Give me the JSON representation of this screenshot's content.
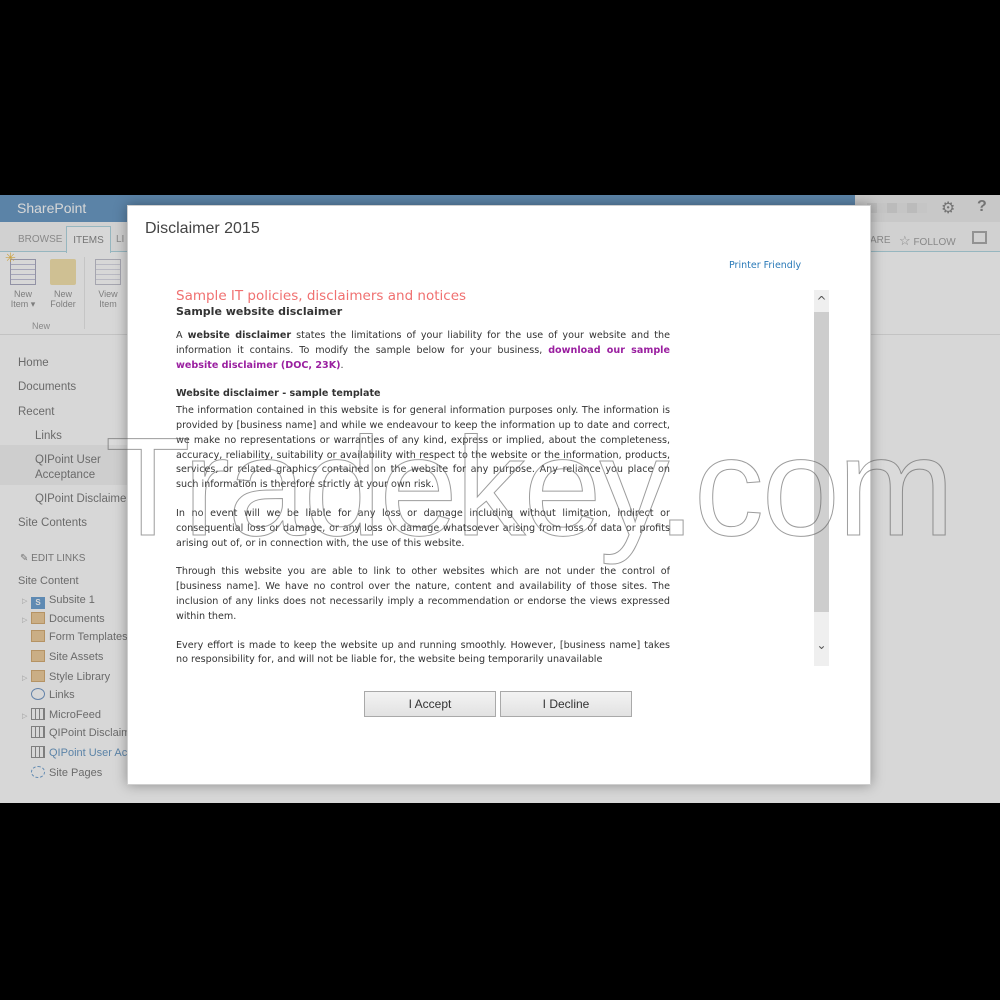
{
  "suitebar": {
    "brand": "SharePoint",
    "settings_icon": "gear-icon",
    "help_label": "?"
  },
  "ribbon": {
    "tabs": [
      {
        "label": "BROWSE"
      },
      {
        "label": "ITEMS",
        "selected": true
      },
      {
        "label": "LI"
      }
    ],
    "share_label": "ARE",
    "follow_label": "FOLLOW",
    "buttons": [
      {
        "label_line1": "New",
        "label_line2": "Item ▾",
        "icon": "new-item-icon"
      },
      {
        "label_line1": "New",
        "label_line2": "Folder",
        "icon": "folder-icon"
      },
      {
        "label_line1": "View",
        "label_line2": "Item",
        "icon": "view-item-icon"
      }
    ],
    "group_label": "New"
  },
  "leftnav": {
    "quicklaunch": [
      {
        "label": "Home"
      },
      {
        "label": "Documents"
      },
      {
        "label": "Recent"
      },
      {
        "label": "Links"
      },
      {
        "label": "QIPoint User"
      },
      {
        "label": "Acceptance"
      },
      {
        "label": "QIPoint Disclaimer"
      },
      {
        "label": "Site Contents"
      }
    ],
    "edit_links": "EDIT LINKS",
    "site_content_label": "Site Content",
    "tree": [
      {
        "label": "Subsite 1",
        "expandable": true
      },
      {
        "label": "Documents",
        "expandable": true
      },
      {
        "label": "Form Templates",
        "expandable": false
      },
      {
        "label": "Site Assets",
        "expandable": false
      },
      {
        "label": "Style Library",
        "expandable": true
      },
      {
        "label": "Links",
        "expandable": false
      },
      {
        "label": "MicroFeed",
        "expandable": true
      },
      {
        "label": "QIPoint Disclaimer",
        "expandable": false
      },
      {
        "label": "QIPoint User Acceptance",
        "expandable": false,
        "active": true
      },
      {
        "label": "Site Pages",
        "expandable": false
      }
    ]
  },
  "dialog": {
    "title": "Disclaimer 2015",
    "printer_friendly": "Printer Friendly",
    "heading": "Sample IT policies, disclaimers and notices",
    "subheading": "Sample website disclaimer",
    "intro_prefix": "A ",
    "intro_bold": "website disclaimer",
    "intro_text": " states the limitations of your liability for the use of your website and the information it contains. To modify the sample below for your business, ",
    "intro_link": "download our sample website disclaimer (DOC, 23K)",
    "intro_suffix": ".",
    "template_heading": "Website disclaimer - sample template",
    "paragraphs": [
      "The information contained in this website is for general information purposes only. The information is provided by [business name] and while we endeavour to keep the information up to date and correct, we make no representations or warranties of any kind, express or implied, about the completeness, accuracy, reliability, suitability or availability with respect to the website or the information, products, services, or related graphics contained on the website for any purpose. Any reliance you place on such information is therefore strictly at your own risk.",
      "In no event will we be liable for any loss or damage including without limitation, indirect or consequential loss or damage, or any loss or damage whatsoever arising from loss of data or profits arising out of, or in connection with, the use of this website.",
      "Through this website you are able to link to other websites which are not under the control of [business name]. We have no control over the nature, content and availability of those sites. The inclusion of any links does not necessarily imply a recommendation or endorse the views expressed within them.",
      "Every effort is made to keep the website up and running smoothly. However, [business name] takes no responsibility for, and will not be liable for, the website being temporarily unavailable"
    ],
    "scroll_up": "˄",
    "scroll_down": "˅",
    "accept_label": "I Accept",
    "decline_label": "I Decline"
  },
  "watermark": "Tradekey.com"
}
